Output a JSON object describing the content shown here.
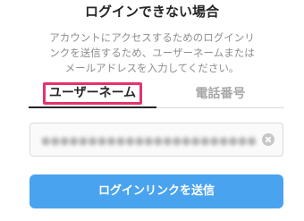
{
  "header": {
    "title": "ログインできない場合"
  },
  "description": {
    "lines": [
      "アカウントにアクセスするためのログインリ",
      "ンクを送信するため、ユーザーネームまたは",
      "メールアドレスを入力してください。"
    ]
  },
  "tabs": [
    {
      "label": "ユーザーネーム",
      "active": true
    },
    {
      "label": "電話番号",
      "active": false
    }
  ],
  "input": {
    "value": "●●●●●●●●●●●●●●●●●●●●●●●●",
    "clear_icon": "clear-circle-x"
  },
  "actions": {
    "send_label": "ログインリンクを送信"
  },
  "colors": {
    "primary": "#4aa3ee",
    "highlight_border": "#e5336a",
    "muted_text": "#8e8e8e"
  }
}
